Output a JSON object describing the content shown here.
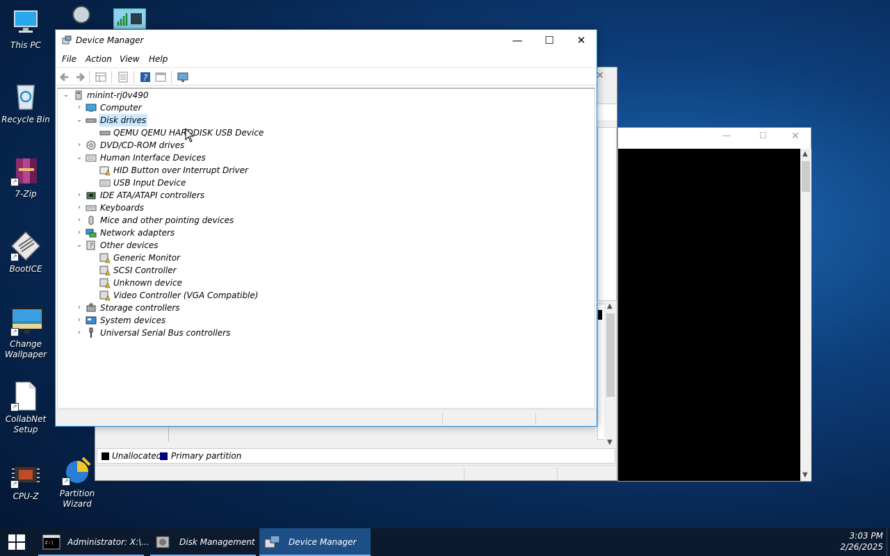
{
  "desktop": {
    "icons": [
      {
        "label": "This PC"
      },
      {
        "label": "Recycle Bin"
      },
      {
        "label": "7-Zip"
      },
      {
        "label": "BootICE"
      },
      {
        "label": "Change Wallpaper"
      },
      {
        "label": "CollabNet Setup"
      },
      {
        "label": "CPU-Z"
      },
      {
        "label": "Partition Wizard"
      }
    ]
  },
  "disk_mgmt_bg": {
    "legend_unallocated": "Unallocated",
    "legend_primary": "Primary partition",
    "colors": {
      "unallocated": "#000000",
      "primary": "#00007f"
    }
  },
  "devmgr": {
    "title": "Device Manager",
    "controls": {
      "minimize": "—",
      "maximize": "☐",
      "close": "✕"
    },
    "menu": {
      "file": "File",
      "action": "Action",
      "view": "View",
      "help": "Help"
    },
    "tree": {
      "root": "minint-rj0v490",
      "computer": "Computer",
      "disk_drives": "Disk drives",
      "disk_child_1": "QEMU QEMU HARDDISK USB Device",
      "dvd": "DVD/CD-ROM drives",
      "hid": "Human Interface Devices",
      "hid_child_1": "HID Button over Interrupt Driver",
      "hid_child_2": "USB Input Device",
      "ide": "IDE ATA/ATAPI controllers",
      "keyboards": "Keyboards",
      "mice": "Mice and other pointing devices",
      "network": "Network adapters",
      "other": "Other devices",
      "other_child_1": "Generic Monitor",
      "other_child_2": "SCSI Controller",
      "other_child_3": "Unknown device",
      "other_child_4": "Video Controller (VGA Compatible)",
      "storage": "Storage controllers",
      "system": "System devices",
      "usb": "Universal Serial Bus controllers"
    },
    "selected_item": "Disk drives",
    "accent": "#1883d7"
  },
  "taskbar": {
    "items": [
      {
        "label": "Administrator: X:\\..."
      },
      {
        "label": "Disk Management"
      },
      {
        "label": "Device Manager"
      }
    ],
    "active_item": "Device Manager",
    "time": "3:03 PM",
    "date": "2/26/2025"
  }
}
